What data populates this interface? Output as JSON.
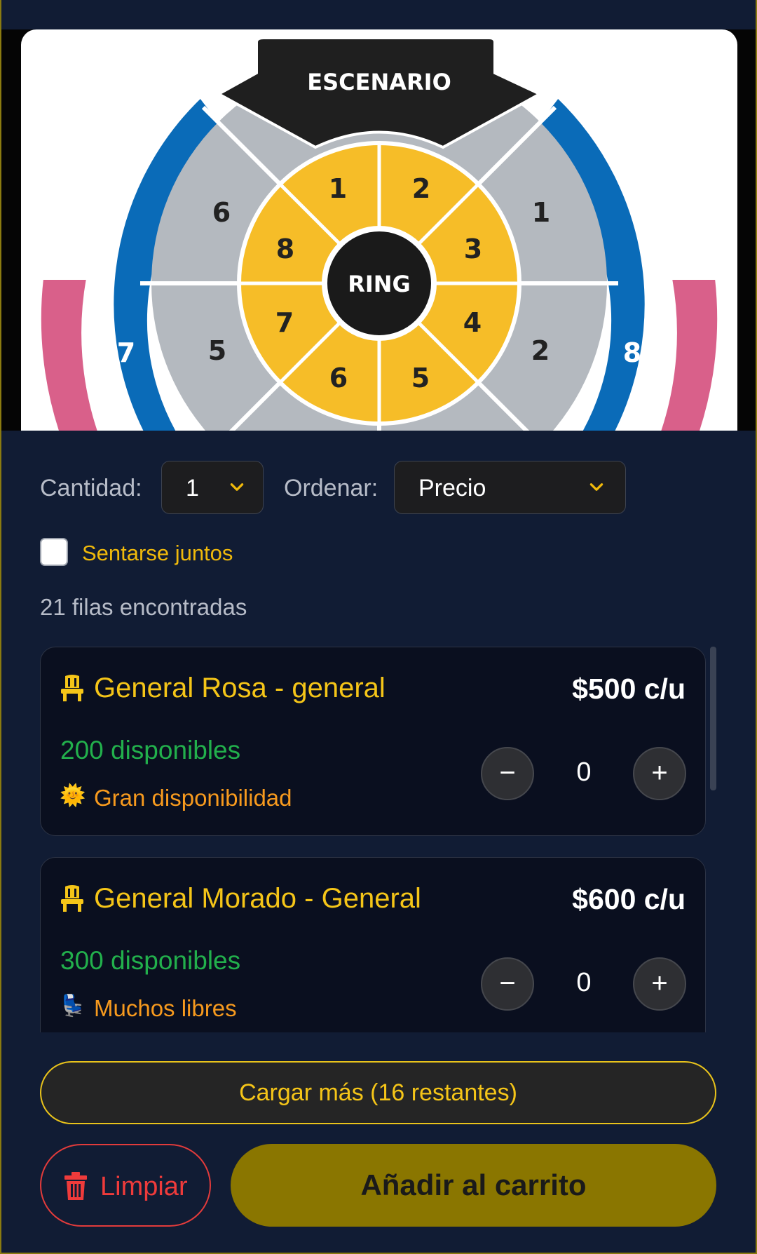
{
  "venue_map": {
    "stage_label": "ESCENARIO",
    "center_label": "RING",
    "inner_sections": [
      "1",
      "2",
      "3",
      "4",
      "5",
      "6",
      "7",
      "8"
    ],
    "middle_sections": [
      "6",
      "1",
      "5",
      "2"
    ],
    "outer_sections": [
      "7",
      "8"
    ]
  },
  "filters": {
    "quantity_label": "Cantidad:",
    "quantity_value": "1",
    "sort_label": "Ordenar:",
    "sort_value": "Precio"
  },
  "together": {
    "label": "Sentarse juntos",
    "checked": false
  },
  "results_count": "21 filas encontradas",
  "rows": [
    {
      "name": "General Rosa - general",
      "price": "$500 c/u",
      "available": "200 disponibles",
      "hint_icon": "sun-emoji",
      "hint": "Gran disponibilidad",
      "quantity": "0",
      "minus": "−",
      "plus": "+"
    },
    {
      "name": "General Morado - General",
      "price": "$600 c/u",
      "available": "300 disponibles",
      "hint_icon": "seat-emoji",
      "hint": "Muchos libres",
      "quantity": "0",
      "minus": "−",
      "plus": "+"
    }
  ],
  "actions": {
    "load_more": "Cargar más (16 restantes)",
    "clear": "Limpiar",
    "add_to_cart": "Añadir al carrito"
  },
  "colors": {
    "background": "#111c34",
    "accent": "#f5c518",
    "available": "#22b04c",
    "hint": "#f79a1e",
    "danger": "#e23b3b",
    "add_button": "#8a7600"
  }
}
